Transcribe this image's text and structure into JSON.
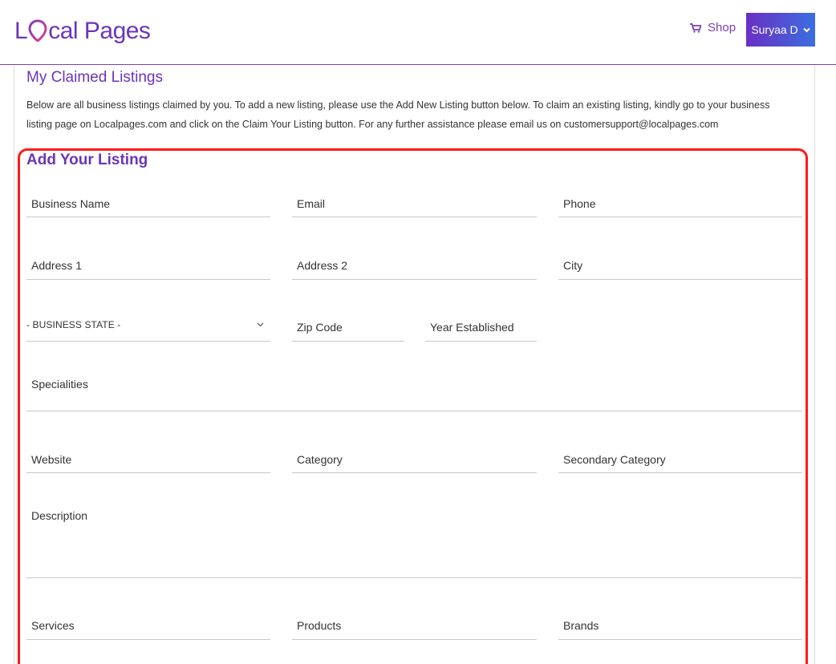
{
  "header": {
    "logo": {
      "part1": "L",
      "part2": "cal Pages"
    },
    "shop_label": "Shop",
    "user_label": "Suryaa D",
    "brand_color": "#6b35b8"
  },
  "page": {
    "title": "My Claimed Listings",
    "intro_line1": "Below are all business listings claimed by you. To add a new listing, please use the Add New Listing button below. To claim an existing listing, kindly go to your business",
    "intro_line2": "listing page on Localpages.com and click on the Claim Your Listing button. For any further assistance please email us on customersupport@localpages.com"
  },
  "form": {
    "title": "Add Your Listing",
    "fields": {
      "business_name": "Business Name",
      "email": "Email",
      "phone": "Phone",
      "address1": "Address 1",
      "address2": "Address 2",
      "city": "City",
      "state": "- BUSINESS STATE -",
      "zip": "Zip Code",
      "year": "Year Established",
      "specialities": "Specialities",
      "website": "Website",
      "category": "Category",
      "secondary_category": "Secondary Category",
      "description": "Description",
      "services": "Services",
      "products": "Products",
      "brands": "Brands"
    }
  },
  "highlight_color": "#ff1a1a"
}
